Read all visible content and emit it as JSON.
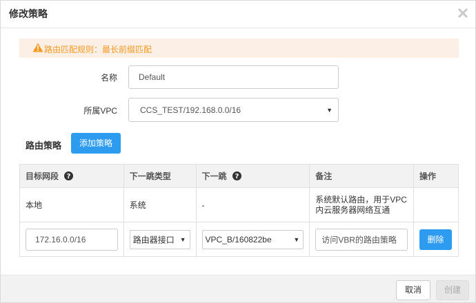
{
  "dialog": {
    "title": "修改策略",
    "close_icon": "close-icon"
  },
  "alert": {
    "icon": "warning-icon",
    "text": "路由匹配规则：最长前缀匹配",
    "color": "#f59a23",
    "background": "#fcefe6"
  },
  "form": {
    "name_label": "名称",
    "name_value": "Default",
    "vpc_label": "所属VPC",
    "vpc_value": "CCS_TEST/192.168.0.0/16"
  },
  "policy_section": {
    "title": "路由策略",
    "add_button": "添加策略",
    "accent": "#2d9bf0"
  },
  "table": {
    "headers": {
      "dest": "目标网段",
      "next_hop_type": "下一跳类型",
      "next_hop": "下一跳",
      "remark": "备注",
      "action": "操作"
    },
    "rows": [
      {
        "dest": "本地",
        "next_hop_type": "系统",
        "next_hop": "-",
        "remark_line1": "系统默认路由，用于VPC",
        "remark_line2": "内云服务器网络互通",
        "action": ""
      }
    ],
    "edit_row": {
      "dest": "172.16.0.0/16",
      "next_hop_type": "路由器接口",
      "next_hop": "VPC_B/160822be",
      "remark": "访问VBR的路由策略",
      "delete_button": "删除"
    }
  },
  "footer": {
    "cancel": "取消",
    "create": "创建"
  }
}
